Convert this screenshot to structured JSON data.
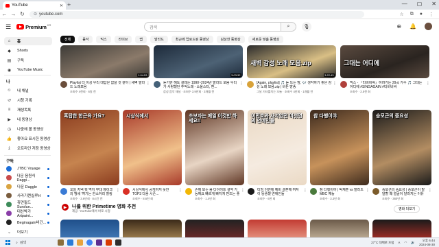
{
  "browser": {
    "tab_title": "YouTube",
    "new_tab": "+",
    "url": "youtube.com",
    "win_min": "—",
    "win_max": "▢",
    "win_close": "✕"
  },
  "header": {
    "logo_text": "Premium",
    "logo_suffix": "KR",
    "search_placeholder": "검색"
  },
  "sidebar": {
    "items": [
      {
        "label": "홈",
        "icon": "home-icon",
        "glyph": "⌂"
      },
      {
        "label": "Shorts",
        "icon": "shorts-icon",
        "glyph": "◆"
      },
      {
        "label": "구독",
        "icon": "subscriptions-icon",
        "glyph": "▤"
      },
      {
        "label": "YouTube Music",
        "icon": "music-icon",
        "glyph": "◉"
      }
    ],
    "you_header": "나",
    "you_items": [
      {
        "label": "내 채널",
        "icon": "channel-icon",
        "glyph": "☺"
      },
      {
        "label": "시청 기록",
        "icon": "history-icon",
        "glyph": "↺"
      },
      {
        "label": "재생목록",
        "icon": "playlist-icon",
        "glyph": "≡"
      },
      {
        "label": "내 동영상",
        "icon": "my-videos-icon",
        "glyph": "▶"
      },
      {
        "label": "나중에 볼 동영상",
        "icon": "watch-later-icon",
        "glyph": "◷"
      },
      {
        "label": "좋아요 표시한 동영상",
        "icon": "like-icon",
        "glyph": "👍"
      },
      {
        "label": "오프라인 저장 동영상",
        "icon": "download-icon",
        "glyph": "⤓"
      }
    ],
    "subs_header": "구독",
    "subs": [
      {
        "label": "JTBC Voyage",
        "color": "#1e6fd9"
      },
      {
        "label": "다문 음원식 Daggi...",
        "color": "#c94b4b"
      },
      {
        "label": "다문 Daggle",
        "color": "#d9a441"
      },
      {
        "label": "사라기렌실루H",
        "color": "#7a5c3e"
      },
      {
        "label": "휴먼필드 Surolun...",
        "color": "#3d8b5a"
      },
      {
        "label": "대신박가 Artpaint...",
        "color": "#8a3ea8"
      },
      {
        "label": "Beginagain비긴...",
        "color": "#222222"
      }
    ],
    "more_label": "더보기"
  },
  "chips": [
    "전체",
    "음악",
    "믹스",
    "라이브",
    "랩",
    "발라드",
    "최근에 업로드된 동영상",
    "감상한 동영상",
    "새로운 맞춤 동영상"
  ],
  "row1": [
    {
      "title": "Playlist 더 이상 우리 대답은 없을 것 같아 | 새벽 발라드 노래모음",
      "meta": "조회수 4천회 · 6일 전",
      "duration": "1:04:53",
      "avatar": "#6a4e3b",
      "thumb": "#3c3a36",
      "thumb2": "#8b7a6a"
    },
    {
      "title": "듣기만 해도 설레는 1990~2024년 발라드 모음 우리가 사랑했던 추억노래 - 소울스타, 환...",
      "meta": "감성 음악 채널 · 조회수 3.9만회 · 3개월 전",
      "duration": "3:03:32",
      "avatar": "#456178",
      "thumb": "#1d2a3a",
      "thumb2": "#4d6275"
    },
    {
      "title": "[Again, playlist] 🎵 듣 드는 밤, 🎶 생각하기 좋은 감성 노래 모음.zip | 비튼 방송",
      "meta": "그날 기타를치는 오늘 · 조회수 4만회 · 1개월 전",
      "duration": "3:22:43",
      "avatar": "#d8a23a",
      "thumb": "#2b2b2b",
      "thumb2": "#d9bf85",
      "caption": "새벽 감성 노래 모음.zip"
    },
    {
      "title": "믹스 - 『티비비싸』하려거든 29곡 가수 🎵 그대는 어디에 #SINGAGAIN #티비비싸",
      "meta": "조회수 · 2.5천 회",
      "duration": "",
      "avatar": "#b0403b",
      "thumb": "#5a4a3f",
      "thumb2": "#2a2420",
      "caption": "그대는 어디에"
    }
  ],
  "row2": [
    {
      "title": "오늘 저녁 뭐 먹지 무대 메이크 의 맹세 '여기는 한소하리 힐링 다이어트...",
      "meta": "조회수 · 3.6만회 · 8시간 전",
      "duration": "",
      "avatar": "#3a7bd5",
      "thumb": "#8a3b1e",
      "thumb2": "#c6844f",
      "caption": "혹탑한 한근육 가요?"
    },
    {
      "title": "시상식에서 공개하지 못한 TOP3 다음 시즌...",
      "meta": "조회수 · 8.6천 회",
      "duration": "",
      "avatar": "#d93025",
      "thumb": "#a83a2a",
      "thumb2": "#f0c08a",
      "caption": "시상식에서"
    },
    {
      "title": "손해 보는 몸 다이어트 절약 가능해요 빠르게 빠지게 만드는 좋은 다이어트 법",
      "meta": "조회수 · 1.4만 회",
      "duration": "",
      "avatar": "#f2b705",
      "thumb": "#5f3624",
      "thumb2": "#e8d5c4",
      "caption": "초보자는 매일 이것만 하세요!!"
    },
    {
      "title": "티빙 이번에 예비 결혼해 여자 이 뚱뚱했 연애인들",
      "meta": "조회수 · 6천 회",
      "duration": "",
      "avatar": "#1a1a1a",
      "thumb": "#ead9c4",
      "thumb2": "#f5ebe0",
      "caption": "이민호와 사겨었던 여섯명의 연예인들"
    },
    {
      "title": "참 다행이야 | 탁재훈 vs 발라드 MBC 예능",
      "meta": "조회수 · 3.3만 회",
      "duration": "",
      "avatar": "#4a7a3c",
      "thumb": "#3d2a1d",
      "thumb2": "#c7925b",
      "caption": "참 다행이야"
    },
    {
      "title": "승모근의 중요성 | 승모근이 발달할 때 얼굴이 달라지는 이유",
      "meta": "조회수 · 360만 회",
      "duration": "",
      "avatar": "#7b5b2b",
      "thumb": "#1a1a1a",
      "thumb2": "#b38d62",
      "caption": "승모근의 중요성"
    }
  ],
  "shelf": {
    "title": "나를 위한 Primetime 영화 추천",
    "subtitle": "제공: YouTube에서 바로 시청",
    "button": "영화 더보기"
  },
  "taskbar": {
    "search": "검색",
    "weather": "27°C 대체로 흐림",
    "time": "오후 6:44",
    "date": "2024-08-30",
    "lang": "A"
  }
}
